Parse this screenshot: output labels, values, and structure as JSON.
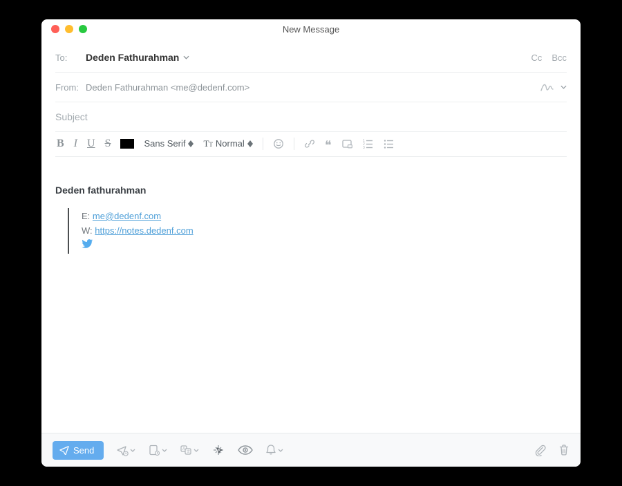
{
  "window": {
    "title": "New Message"
  },
  "header": {
    "to_label": "To:",
    "to_name": "Deden Fathurahman",
    "cc": "Cc",
    "bcc": "Bcc",
    "from_label": "From:",
    "from_value": "Deden Fathurahman <me@dedenf.com>",
    "subject_placeholder": "Subject"
  },
  "toolbar": {
    "bold": "B",
    "italic": "I",
    "underline": "U",
    "strike": "S",
    "font_family": "Sans Serif",
    "font_size_label": "Normal"
  },
  "signature": {
    "name": "Deden fathurahman",
    "email_label": "E:",
    "email": "me@dedenf.com",
    "web_label": "W:",
    "web": "https://notes.dedenf.com"
  },
  "footer": {
    "send": "Send"
  }
}
